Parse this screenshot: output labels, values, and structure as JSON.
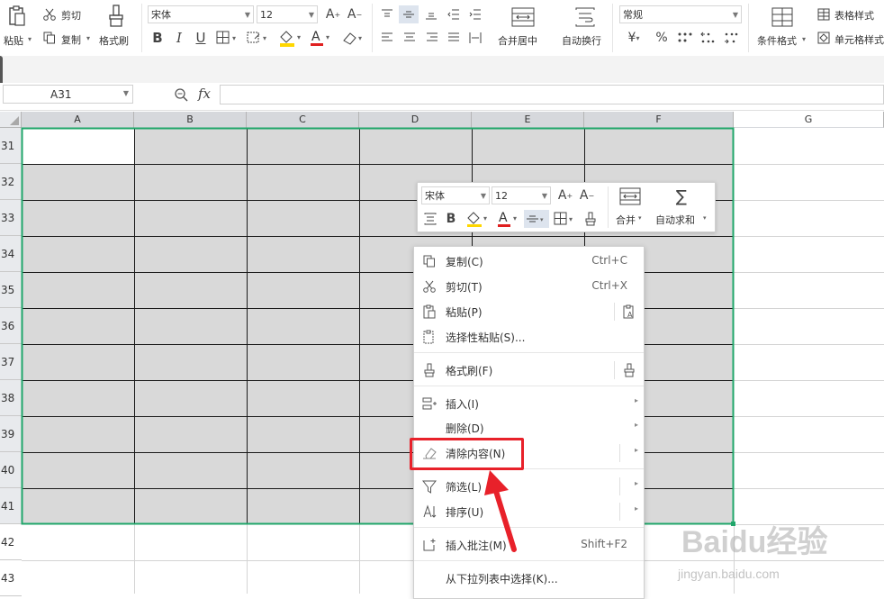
{
  "ribbon": {
    "paste": "粘贴",
    "cut": "剪切",
    "copy": "复制",
    "format_painter": "格式刷",
    "font_name": "宋体",
    "font_size": "12",
    "merge_center": "合并居中",
    "wrap_text": "自动换行",
    "number_format": "常规",
    "currency_symbol": "¥",
    "percent_symbol": "%",
    "conditional_format": "条件格式",
    "table_style": "表格样式",
    "cell_style": "单元格样式"
  },
  "formula_bar": {
    "name_box": "A31",
    "fx": "fx",
    "value": ""
  },
  "columns": [
    "A",
    "B",
    "C",
    "D",
    "E",
    "F",
    "G"
  ],
  "rows": [
    "31",
    "32",
    "33",
    "34",
    "35",
    "36",
    "37",
    "38",
    "39",
    "40",
    "41",
    "42",
    "43"
  ],
  "mini_toolbar": {
    "font_name": "宋体",
    "font_size": "12",
    "merge": "合并",
    "autosum": "自动求和"
  },
  "context_menu": {
    "copy": "复制(C)",
    "copy_shortcut": "Ctrl+C",
    "cut": "剪切(T)",
    "cut_shortcut": "Ctrl+X",
    "paste": "粘贴(P)",
    "paste_special": "选择性粘贴(S)...",
    "format_painter": "格式刷(F)",
    "insert": "插入(I)",
    "delete": "删除(D)",
    "clear_contents": "清除内容(N)",
    "filter": "筛选(L)",
    "sort": "排序(U)",
    "insert_comment": "插入批注(M)",
    "insert_comment_shortcut": "Shift+F2",
    "pick_from_list": "从下拉列表中选择(K)..."
  },
  "watermark": {
    "brand": "Baidu经验",
    "url": "jingyan.baidu.com"
  },
  "colors": {
    "selection_border": "#20a66a",
    "selected_fill": "#d9d9d9",
    "highlight_box": "#e8212a",
    "annotation_arrow": "#e8212a",
    "font_color_underline": "#e02020",
    "fill_color_underline": "#ffd700"
  }
}
